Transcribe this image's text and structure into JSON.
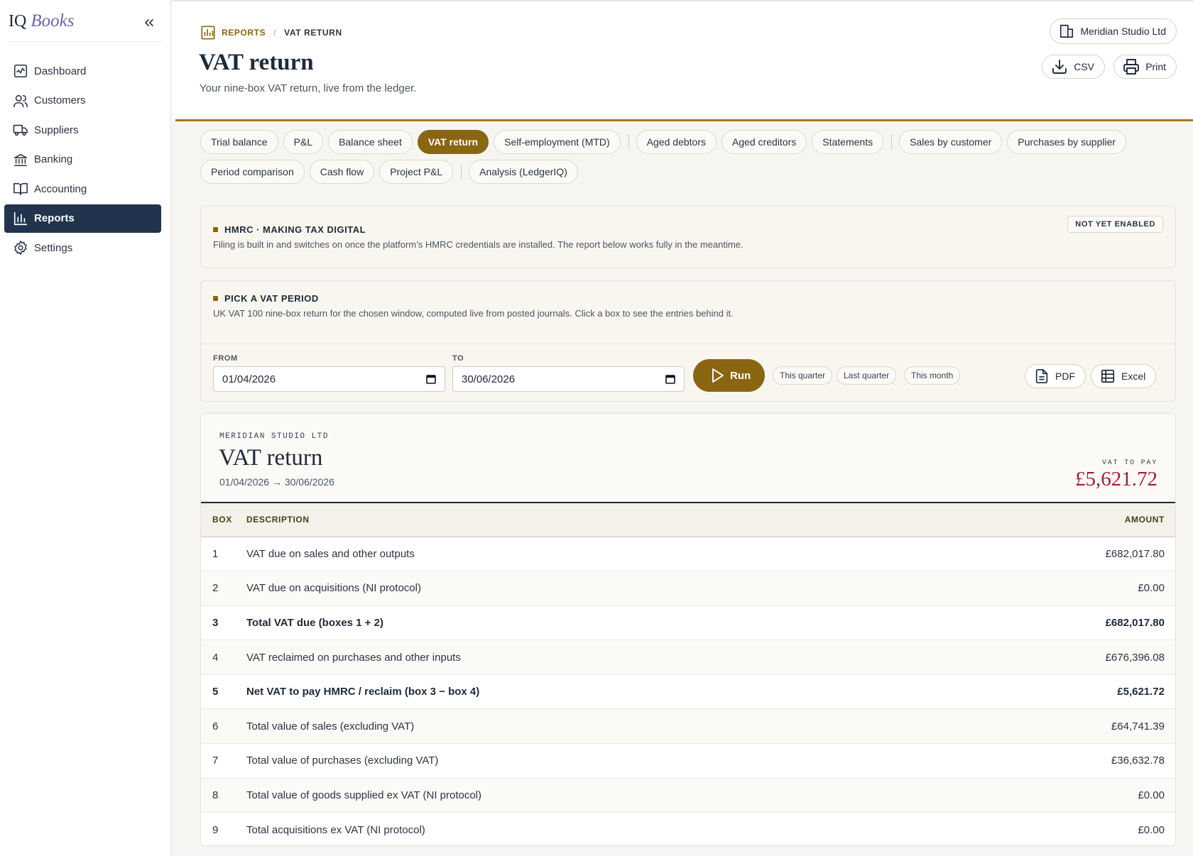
{
  "brand": {
    "name_a": "IQ",
    "name_b": "Books"
  },
  "sidebar": {
    "items": [
      {
        "label": "Dashboard",
        "icon": "dashboard-icon"
      },
      {
        "label": "Customers",
        "icon": "customers-icon"
      },
      {
        "label": "Suppliers",
        "icon": "truck-icon"
      },
      {
        "label": "Banking",
        "icon": "bank-icon"
      },
      {
        "label": "Accounting",
        "icon": "book-icon"
      },
      {
        "label": "Reports",
        "icon": "bar-chart-icon",
        "active": true
      },
      {
        "label": "Settings",
        "icon": "gear-icon"
      }
    ]
  },
  "header": {
    "breadcrumb": [
      "REPORTS",
      "VAT RETURN"
    ],
    "title": "VAT return",
    "subtitle": "Your nine-box VAT return, live from the ledger.",
    "company": "Meridian Studio Ltd",
    "csv_label": "CSV",
    "print_label": "Print"
  },
  "tabs": {
    "row1": [
      "Trial balance",
      "P&L",
      "Balance sheet",
      "VAT return",
      "Self-employment (MTD)",
      "Aged debtors",
      "Aged creditors",
      "Statements",
      "Sales by customer",
      "Purchases by supplier"
    ],
    "row2": [
      "Period comparison",
      "Cash flow",
      "Project P&L",
      "Analysis (LedgerIQ)"
    ],
    "active": "VAT return"
  },
  "hmrc": {
    "title": "HMRC · MAKING TAX DIGITAL",
    "text": "Filing is built in and switches on once the platform’s HMRC credentials are installed. The report below works fully in the meantime.",
    "badge": "NOT YET ENABLED"
  },
  "period": {
    "title": "PICK A VAT PERIOD",
    "text": "UK VAT 100 nine-box return for the chosen window, computed live from posted journals. Click a box to see the entries behind it.",
    "from_label": "FROM",
    "from_value": "01/04/2026",
    "to_label": "TO",
    "to_value": "30/06/2026",
    "run_label": "Run",
    "presets": [
      "This quarter",
      "Last quarter",
      "This month"
    ],
    "pdf_label": "PDF",
    "excel_label": "Excel"
  },
  "report": {
    "company": "MERIDIAN STUDIO LTD",
    "title": "VAT return",
    "range": "01/04/2026 → 30/06/2026",
    "due_label": "VAT TO PAY",
    "due_amount": "£5,621.72",
    "columns": [
      "BOX",
      "DESCRIPTION",
      "AMOUNT"
    ],
    "rows": [
      {
        "box": "1",
        "description": "VAT due on sales and other outputs",
        "amount": "£682,017.80",
        "total": false
      },
      {
        "box": "2",
        "description": "VAT due on acquisitions (NI protocol)",
        "amount": "£0.00",
        "total": false
      },
      {
        "box": "3",
        "description": "Total VAT due (boxes 1 + 2)",
        "amount": "£682,017.80",
        "total": true
      },
      {
        "box": "4",
        "description": "VAT reclaimed on purchases and other inputs",
        "amount": "£676,396.08",
        "total": false
      },
      {
        "box": "5",
        "description": "Net VAT to pay HMRC / reclaim (box 3 − box 4)",
        "amount": "£5,621.72",
        "total": true
      },
      {
        "box": "6",
        "description": "Total value of sales (excluding VAT)",
        "amount": "£64,741.39",
        "total": false
      },
      {
        "box": "7",
        "description": "Total value of purchases (excluding VAT)",
        "amount": "£36,632.78",
        "total": false
      },
      {
        "box": "8",
        "description": "Total value of goods supplied ex VAT (NI protocol)",
        "amount": "£0.00",
        "total": false
      },
      {
        "box": "9",
        "description": "Total acquisitions ex VAT (NI protocol)",
        "amount": "£0.00",
        "total": false
      }
    ]
  },
  "colors": {
    "accent": "#8a6512",
    "navy": "#22344d",
    "due": "#9d1c3f"
  }
}
